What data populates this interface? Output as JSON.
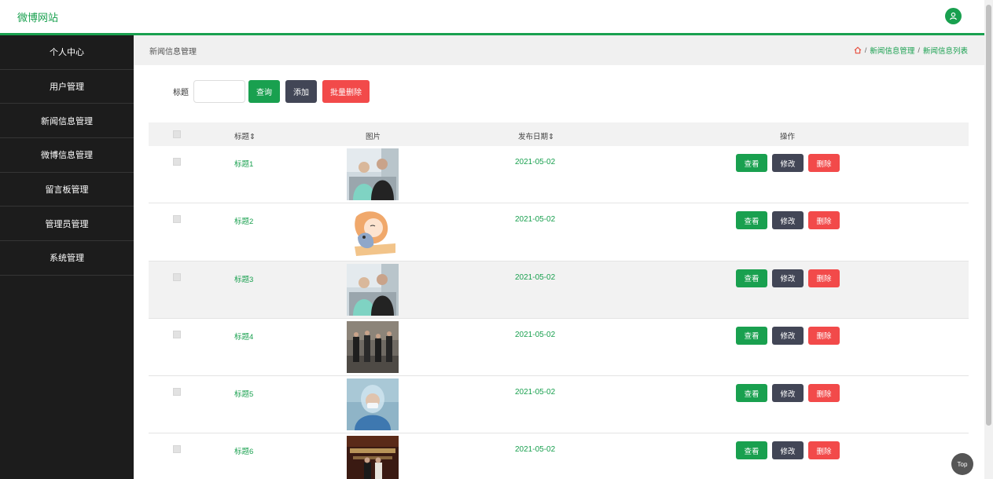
{
  "brand": "微博网站",
  "sidebar": {
    "items": [
      {
        "label": "个人中心"
      },
      {
        "label": "用户管理"
      },
      {
        "label": "新闻信息管理"
      },
      {
        "label": "微博信息管理"
      },
      {
        "label": "留言板管理"
      },
      {
        "label": "管理员管理"
      },
      {
        "label": "系统管理"
      }
    ]
  },
  "crumbbar": {
    "title": "新闻信息管理",
    "breadcrumb": [
      "新闻信息管理",
      "新闻信息列表"
    ]
  },
  "search": {
    "label": "标题",
    "value": "",
    "query_label": "查询",
    "add_label": "添加",
    "batch_delete_label": "批量删除"
  },
  "table": {
    "headers": {
      "title": "标题",
      "image": "图片",
      "date": "发布日期",
      "actions": "操作"
    },
    "rows": [
      {
        "title": "标题1",
        "date": "2021-05-02",
        "image": "photo-two-men-seated"
      },
      {
        "title": "标题2",
        "date": "2021-05-02",
        "image": "cartoon-girl-hugging-cat"
      },
      {
        "title": "标题3",
        "date": "2021-05-02",
        "image": "photo-two-men-seated"
      },
      {
        "title": "标题4",
        "date": "2021-05-02",
        "image": "photo-group-in-hall"
      },
      {
        "title": "标题5",
        "date": "2021-05-02",
        "image": "photo-medical-worker-face-shield"
      },
      {
        "title": "标题6",
        "date": "2021-05-02",
        "image": "photo-award-stage"
      }
    ],
    "action_labels": {
      "view": "查看",
      "edit": "修改",
      "delete": "删除"
    }
  },
  "top_button": "Top",
  "colors": {
    "accent": "#19a04f",
    "dark_button": "#424656",
    "danger": "#f24a4a",
    "sidebar": "#1c1c1c"
  }
}
